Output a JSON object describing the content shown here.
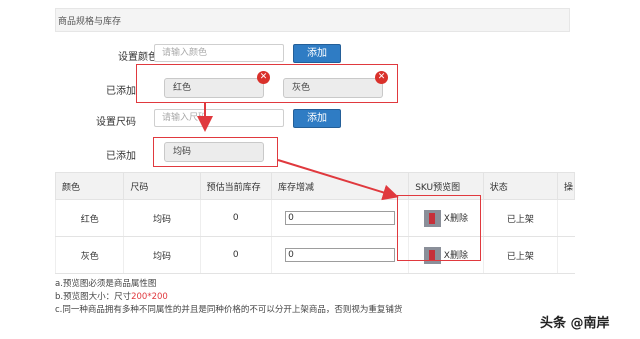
{
  "section": {
    "title": "商品规格与库存"
  },
  "color": {
    "label": "设置颜色",
    "placeholder": "请输入颜色",
    "add_button": "添加",
    "added_label": "已添加",
    "tags": [
      "红色",
      "灰色"
    ]
  },
  "size": {
    "label": "设置尺码",
    "placeholder": "请输入尺码",
    "add_button": "添加",
    "added_label": "已添加",
    "tags": [
      "均码"
    ]
  },
  "table": {
    "headers": [
      "颜色",
      "尺码",
      "预估当前库存",
      "库存增减",
      "SKU预览图",
      "状态",
      "操"
    ],
    "rows": [
      {
        "color": "红色",
        "size": "均码",
        "stock": "0",
        "delta": "0",
        "delete": "X删除",
        "status": "已上架"
      },
      {
        "color": "灰色",
        "size": "均码",
        "stock": "0",
        "delta": "0",
        "delete": "X删除",
        "status": "已上架"
      }
    ]
  },
  "notes": {
    "line_a": "a.预览图必须是商品属性图",
    "line_b_prefix": "b.预览图大小：尺寸",
    "line_b_value": "200*200",
    "line_c": "c.同一种商品拥有多种不同属性的并且是同种价格的不可以分开上架商品，否则视为重复铺货"
  },
  "watermark": "头条 @南岸",
  "colors": {
    "accent": "#2f7cc4",
    "annotation_red": "#e0393e",
    "tag_delete": "#d9312b"
  }
}
